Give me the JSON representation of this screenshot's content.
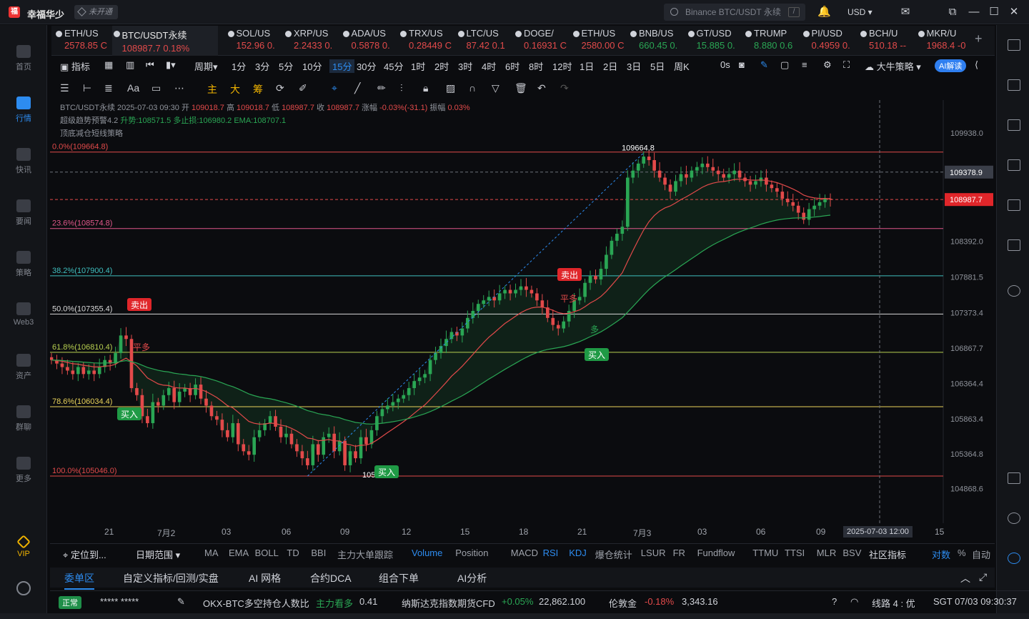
{
  "app": {
    "name": "幸福华少",
    "badge": "未开通",
    "search_placeholder": "Binance BTC/USDT 永续",
    "currency": "USD"
  },
  "sidebar": [
    {
      "label": "首页"
    },
    {
      "label": "行情"
    },
    {
      "label": "快讯"
    },
    {
      "label": "要闻"
    },
    {
      "label": "策略"
    },
    {
      "label": "Web3"
    },
    {
      "label": "资产"
    },
    {
      "label": "群聊"
    },
    {
      "label": "更多"
    },
    {
      "label": "VIP"
    }
  ],
  "tickers": [
    {
      "symbol": "ETH/US",
      "price": "2578.85 C",
      "color": "#e24a4a"
    },
    {
      "symbol": "BTC/USDT永续",
      "price": "108987.7  0.18%",
      "color": "#e24a4a"
    },
    {
      "symbol": "SOL/US",
      "price": "152.96  0.",
      "color": "#e24a4a"
    },
    {
      "symbol": "XRP/US",
      "price": "2.2433  0.",
      "color": "#e24a4a"
    },
    {
      "symbol": "ADA/US",
      "price": "0.5878  0.",
      "color": "#e24a4a"
    },
    {
      "symbol": "TRX/US",
      "price": "0.28449  C",
      "color": "#e24a4a"
    },
    {
      "symbol": "LTC/US",
      "price": "87.42  0.1",
      "color": "#e24a4a"
    },
    {
      "symbol": "DOGE/",
      "price": "0.16931  C",
      "color": "#e24a4a"
    },
    {
      "symbol": "ETH/US",
      "price": "2580.00  C",
      "color": "#e24a4a"
    },
    {
      "symbol": "BNB/US",
      "price": "660.45  0.",
      "color": "#2aa654"
    },
    {
      "symbol": "GT/USD",
      "price": "15.885  0.",
      "color": "#2aa654"
    },
    {
      "symbol": "TRUMP",
      "price": "8.880  0.6",
      "color": "#2aa654"
    },
    {
      "symbol": "PI/USD",
      "price": "0.4959  0.",
      "color": "#e24a4a"
    },
    {
      "symbol": "BCH/U",
      "price": "510.18  --",
      "color": "#e24a4a"
    },
    {
      "symbol": "MKR/U",
      "price": "1968.4  -0",
      "color": "#e24a4a"
    }
  ],
  "toolbar": {
    "indicator": "指标",
    "period": "周期",
    "intervals": [
      "1分",
      "3分",
      "5分",
      "10分",
      "15分",
      "30分",
      "45分",
      "1时",
      "2时",
      "3时",
      "4时",
      "6时",
      "8时",
      "12时",
      "1日",
      "2日",
      "3日",
      "5日",
      "周K"
    ],
    "active_interval": "15分",
    "countdown": "0s",
    "strategy": "大牛策略",
    "ai": "AI解读"
  },
  "draw_tools": [
    "主",
    "大",
    "筹"
  ],
  "legend": {
    "line1_prefix": "BTC/USDT永续  2025-07-03 09:30  开",
    "open": "109018.7",
    "high_label": "高",
    "high": "109018.7",
    "low_label": "低",
    "low": "108987.7",
    "close_label": "收",
    "close": "108987.7",
    "chg_label": "涨幅",
    "chg": "-0.03%(-31.1)",
    "amp_label": "振幅",
    "amp": "0.03%",
    "line2": "超级趋势预警4.2",
    "line2b": "升势:108571.5  多止损:106980.2  EMA:108707.1",
    "line3": "顶底减仓短线策略"
  },
  "chart_data": {
    "type": "candlestick",
    "symbol": "BTC/USDT永续",
    "interval": "15分",
    "ylim": [
      104700,
      110100
    ],
    "y_ticks": [
      "109938.0",
      "109378.9",
      "108987.7",
      "108392.0",
      "107881.5",
      "107373.4",
      "106867.7",
      "106364.4",
      "105863.4",
      "105364.8",
      "104868.6"
    ],
    "current_price": "108987.7",
    "crosshair_price": "109378.9",
    "crosshair_time": "2025-07-03 12:00",
    "x_ticks": [
      "21",
      "7月2",
      "03",
      "06",
      "09",
      "12",
      "15",
      "18",
      "21",
      "7月3",
      "03",
      "06",
      "09",
      "15"
    ],
    "fib_levels": [
      {
        "label": "0.0%(109664.8)",
        "value": 109664.8,
        "color": "#e24a4a"
      },
      {
        "label": "23.6%(108574.8)",
        "value": 108574.8,
        "color": "#e0578a"
      },
      {
        "label": "38.2%(107900.4)",
        "value": 107900.4,
        "color": "#3fbfbf"
      },
      {
        "label": "50.0%(107355.4)",
        "value": 107355.4,
        "color": "#d8d8d8"
      },
      {
        "label": "61.8%(106810.4)",
        "value": 106810.4,
        "color": "#b8d050"
      },
      {
        "label": "78.6%(106034.4)",
        "value": 106034.4,
        "color": "#e8d25a"
      },
      {
        "label": "100.0%(105046.0)",
        "value": 105046.0,
        "color": "#e24a4a"
      }
    ],
    "high_marker": "109664.8",
    "low_marker": "105046.0",
    "signals": [
      {
        "text": "卖出",
        "type": "sell"
      },
      {
        "text": "买入",
        "type": "buy"
      },
      {
        "text": "买入",
        "type": "buy"
      },
      {
        "text": "卖出",
        "type": "sell"
      },
      {
        "text": "平多",
        "type": "label"
      },
      {
        "text": "买入",
        "type": "buy"
      },
      {
        "text": "多",
        "type": "label"
      },
      {
        "text": "平多",
        "type": "label"
      }
    ],
    "closes": [
      106700,
      106650,
      106600,
      106550,
      106500,
      106600,
      106500,
      106550,
      106500,
      106600,
      106700,
      106650,
      106800,
      107050,
      107000,
      106300,
      106200,
      105900,
      105800,
      106100,
      106050,
      106200,
      106300,
      106100,
      106250,
      106300,
      106200,
      106350,
      106150,
      106050,
      105900,
      105850,
      105700,
      105600,
      105800,
      105500,
      105400,
      105350,
      105600,
      105700,
      105800,
      105900,
      105750,
      105600,
      105650,
      105500,
      105400,
      105300,
      105200,
      105500,
      105350,
      105600,
      105650,
      105400,
      105550,
      105200,
      105400,
      105300,
      105600,
      105500,
      105700,
      105900,
      106000,
      106050,
      106100,
      106150,
      106200,
      106300,
      106400,
      106450,
      106500,
      106700,
      106800,
      106900,
      107000,
      107100,
      107050,
      107150,
      107300,
      107400,
      107500,
      107550,
      107600,
      107550,
      107650,
      107700,
      107650,
      107700,
      107750,
      107700,
      107650,
      107550,
      107450,
      107300,
      107200,
      107150,
      107250,
      107400,
      107550,
      107600,
      107800,
      107900,
      107850,
      108000,
      108200,
      108400,
      108500,
      108600,
      109300,
      109400,
      109500,
      109600,
      109550,
      109400,
      109300,
      109200,
      109100,
      109250,
      109350,
      109300,
      109400,
      109450,
      109500,
      109450,
      109400,
      109350,
      109300,
      109350,
      109400,
      109300,
      109250,
      109200,
      109250,
      109300,
      109200,
      109150,
      109100,
      109000,
      108950,
      108900,
      108800,
      108700,
      108850,
      108900,
      108950,
      109000,
      108987.7
    ]
  },
  "x_time_tag": "2025-07-03 12:00",
  "indicators": [
    "MA",
    "EMA",
    "BOLL",
    "TD",
    "BBI",
    "主力大单跟踪",
    "Volume",
    "Position",
    "MACD",
    "RSI",
    "KDJ",
    "爆仓统计",
    "LSUR",
    "FR",
    "Fundflow",
    "TTMU",
    "TTSI",
    "MLR",
    "BSV"
  ],
  "indicators_active": [
    "Volume",
    "RSI",
    "KDJ"
  ],
  "indbar": {
    "locate": "定位到...",
    "range": "日期范围",
    "community": "社区指标",
    "compare": "对数",
    "pct": "%",
    "auto": "自动"
  },
  "tabs": [
    "委单区",
    "自定义指标/回测/实盘",
    "AI 网格",
    "合约DCA",
    "组合下单",
    "AI分析"
  ],
  "status": {
    "state": "正常",
    "masked": "*****  *****",
    "ratio_name": "OKX-BTC多空持仓人数比",
    "ratio_tag": "主力看多",
    "ratio_val": "0.41",
    "nasdaq": "纳斯达克指数期货CFD",
    "nasdaq_chg": "+0.05%",
    "nasdaq_val": "22,862.100",
    "gold": "伦敦金",
    "gold_chg": "-0.18%",
    "gold_val": "3,343.16",
    "line": "线路 4 : 优",
    "time": "SGT 07/03 09:30:37"
  }
}
